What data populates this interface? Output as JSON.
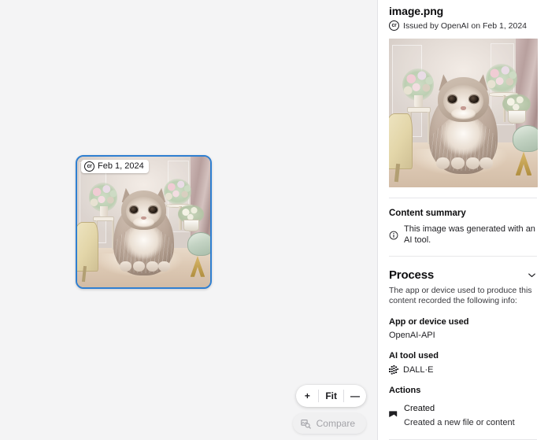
{
  "canvas": {
    "thumbnail": {
      "badge_label": "Feb 1, 2024",
      "badge_icon": "content-credentials-cr-icon",
      "alt": "AI generated illustration of a fluffy cat sitting in an elegant room",
      "selected": true,
      "selection_color": "#2f7fd1"
    },
    "toolbar": {
      "zoom_in_label": "+",
      "fit_label": "Fit",
      "zoom_out_label": "—",
      "compare_label": "Compare",
      "compare_icon": "compare-image-search-icon",
      "compare_disabled": true
    }
  },
  "panel": {
    "file_name": "image.png",
    "issued_by": "Issued by OpenAI on Feb 1, 2024",
    "issued_icon": "content-credentials-cr-icon",
    "preview_alt": "AI generated illustration of a fluffy cat sitting in an elegant room",
    "content_summary": {
      "title": "Content summary",
      "icon": "info-circle-icon",
      "text": "This image was generated with an AI tool."
    },
    "process": {
      "title": "Process",
      "chevron_icon": "chevron-down-icon",
      "description": "The app or device used to produce this content recorded the following info:",
      "app_label": "App or device used",
      "app_value": "OpenAI-API",
      "ai_tool_label": "AI tool used",
      "ai_tool_value": "DALL·E",
      "ai_tool_icon": "dalle-mosaic-icon",
      "actions_label": "Actions",
      "actions": [
        {
          "icon": "created-flag-icon",
          "name": "Created",
          "description": "Created a new file or content"
        }
      ]
    }
  },
  "theme": {
    "canvas_bg": "#f4f4f5",
    "panel_bg": "#ffffff",
    "accent": "#2f7fd1",
    "text": "#0d0d0f",
    "muted": "#3a3a3f",
    "divider": "#e7e7ea"
  }
}
